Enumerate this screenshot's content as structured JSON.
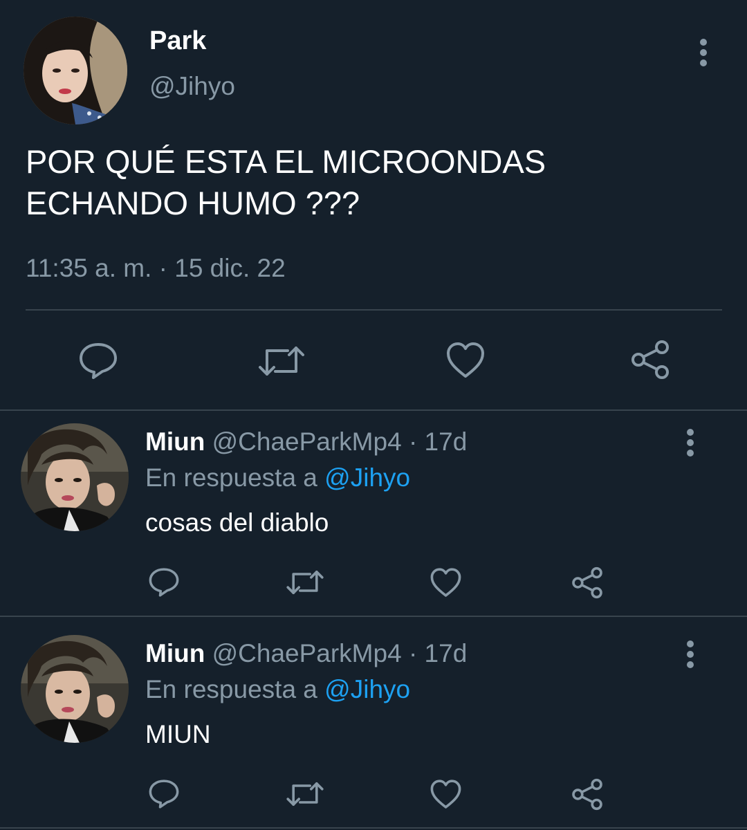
{
  "colors": {
    "background": "#15202b",
    "secondary_text": "#8899a6",
    "mention": "#1da1f2",
    "divider": "#38444d"
  },
  "main_tweet": {
    "name": "Park",
    "handle": "@Jihyo",
    "text": "POR QUÉ ESTA EL MICROONDAS\nECHANDO HUMO ???",
    "timestamp": "11:35 a. m. · 15 dic. 22",
    "icons": [
      "more-vertical-icon",
      "reply-icon",
      "retweet-icon",
      "like-icon",
      "share-icon"
    ]
  },
  "replies": [
    {
      "name": "Miun",
      "handle": "@ChaeParkMp4",
      "time": "· 17d",
      "reply_prefix": "En respuesta a",
      "reply_mention": "@Jihyo",
      "text": "cosas del diablo"
    },
    {
      "name": "Miun",
      "handle": "@ChaeParkMp4",
      "time": "· 17d",
      "reply_prefix": "En respuesta a",
      "reply_mention": "@Jihyo",
      "text": "MIUN"
    }
  ]
}
